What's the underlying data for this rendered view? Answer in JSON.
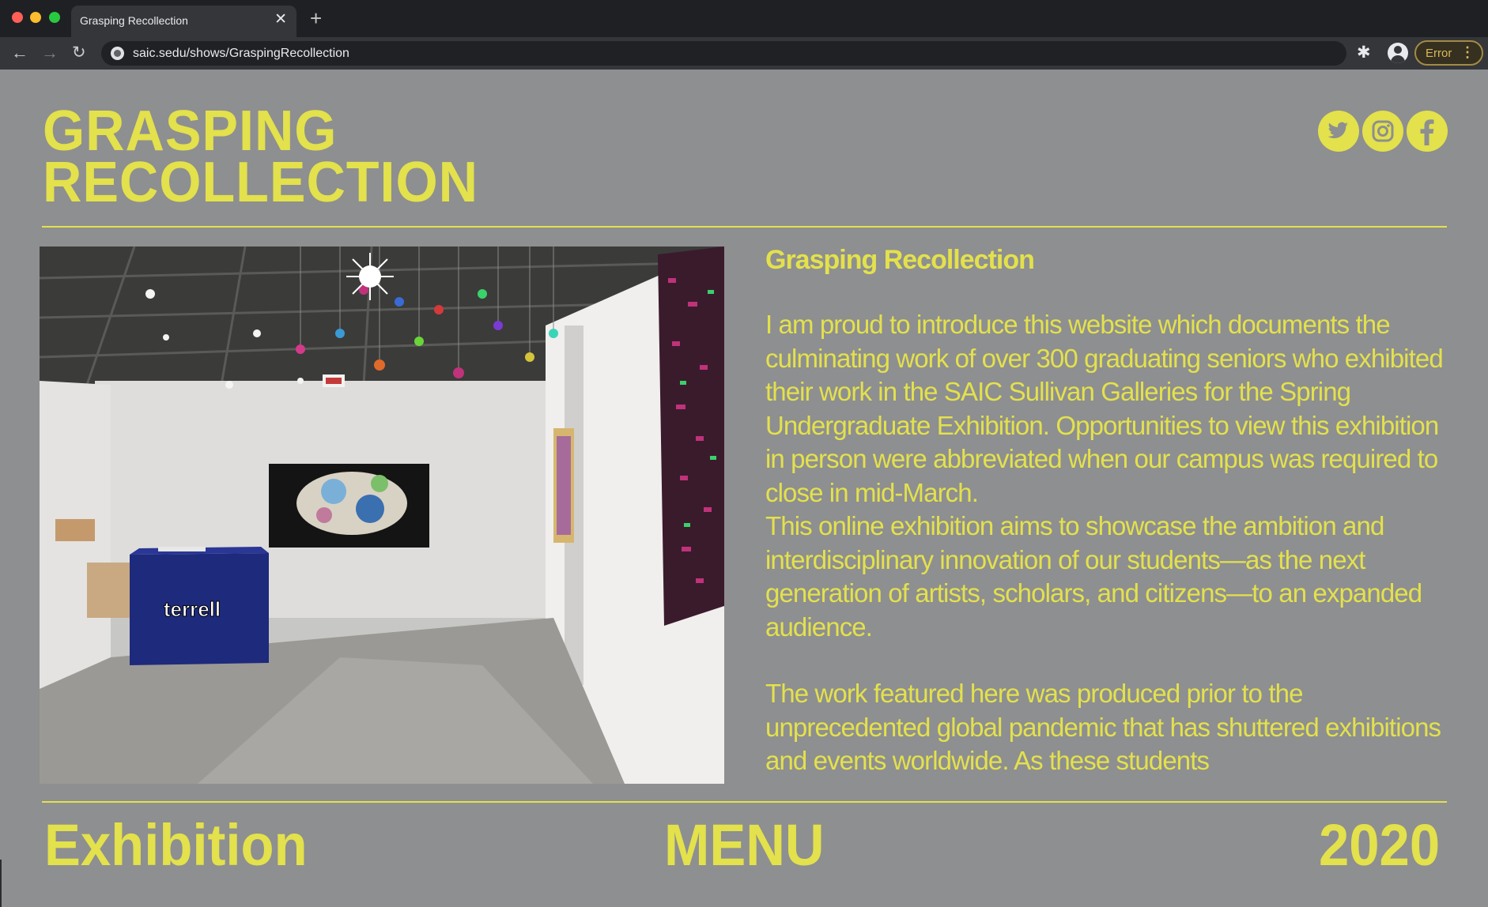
{
  "browser": {
    "tab_title": "Grasping Recollection",
    "tab_close": "✕",
    "new_tab": "+",
    "url": "saic.sedu/shows/GraspingRecollection",
    "error_label": "Error",
    "error_menu": "⋮",
    "back": "←",
    "forward": "→",
    "reload": "↻",
    "extensions": "✱"
  },
  "site": {
    "title_line1": "GRASPING",
    "title_line2": "RECOLLECTION",
    "accent_color": "#e3e14c",
    "background_color": "#8e8f90",
    "socials": [
      {
        "name": "twitter",
        "icon": "twitter-icon"
      },
      {
        "name": "instagram",
        "icon": "instagram-icon"
      },
      {
        "name": "facebook",
        "icon": "facebook-icon"
      }
    ]
  },
  "intro": {
    "heading": "Grasping Recollection",
    "paragraph1": "I am proud to introduce this website which documents the culminating work of over 300 graduating seniors who exhibited their work in the SAIC Sullivan Galleries for the Spring Undergraduate Exhibition. Opportunities to view this exhibition in person were abbreviated when our campus was required to close in mid-March.",
    "paragraph1b": "This online exhibition aims to showcase the ambition and interdisciplinary innovation of our students—as the next generation of artists, scholars, and citizens—to an expanded audience.",
    "paragraph2": "The work featured here was produced prior to the unprecedented global pandemic that has shuttered exhibitions and events worldwide. As these students"
  },
  "hero": {
    "pedestal_label": "terrell"
  },
  "footer": {
    "left": "Exhibition",
    "center": "MENU",
    "right": "2020"
  }
}
